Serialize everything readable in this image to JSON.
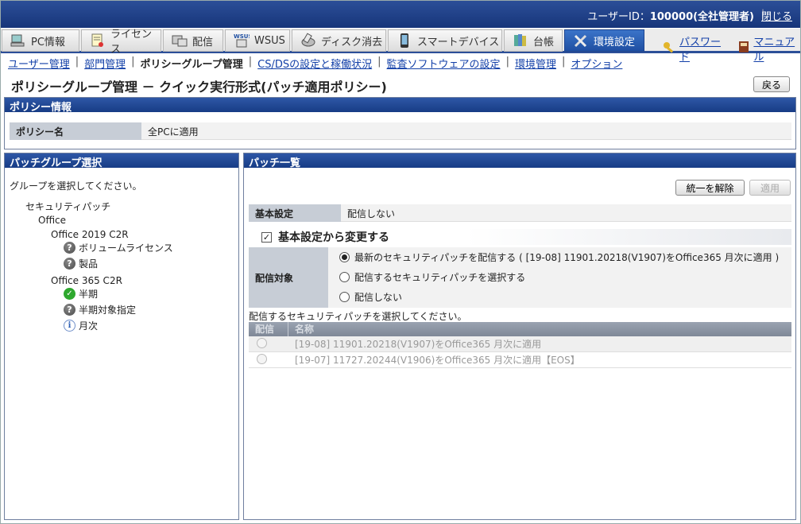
{
  "header": {
    "user_label": "ユーザーID：",
    "user_value": "100000(全社管理者)",
    "sep": "|",
    "logout": "閉じる"
  },
  "tabs": [
    {
      "label": "PC情報",
      "icon": "pc-icon"
    },
    {
      "label": "ライセンス",
      "icon": "license-icon"
    },
    {
      "label": "配信",
      "icon": "delivery-icon"
    },
    {
      "label": "WSUS",
      "icon": "wsus-icon",
      "badge": "WSUS"
    },
    {
      "label": "ディスク消去",
      "icon": "disk-erase-icon"
    },
    {
      "label": "スマートデバイス",
      "icon": "smartphone-icon"
    },
    {
      "label": "台帳",
      "icon": "ledger-icon"
    },
    {
      "label": "環境設定",
      "icon": "tools-icon",
      "active": true
    }
  ],
  "right_links": {
    "password": "パスワード",
    "manual": "マニュアル"
  },
  "submenu": [
    {
      "label": "ユーザー管理",
      "current": false
    },
    {
      "label": "部門管理",
      "current": false
    },
    {
      "label": "ポリシーグループ管理",
      "current": true
    },
    {
      "label": "CS/DSの設定と稼働状況",
      "current": false
    },
    {
      "label": "監査ソフトウェアの設定",
      "current": false
    },
    {
      "label": "環境管理",
      "current": false
    },
    {
      "label": "オプション",
      "current": false
    }
  ],
  "page": {
    "title": "ポリシーグループ管理 － クイック実行形式(パッチ適用ポリシー)",
    "back": "戻る"
  },
  "policy_info": {
    "heading": "ポリシー情報",
    "name_label": "ポリシー名",
    "name_value": "全PCに適用"
  },
  "group_select": {
    "heading": "パッチグループ選択",
    "intro": "グループを選択してください。",
    "tree": {
      "root": "セキュリティパッチ",
      "office": "Office",
      "o2019": "Office 2019 C2R",
      "volume": "ボリュームライセンス",
      "product": "製品",
      "o365": "Office 365 C2R",
      "half": "半期",
      "half_target": "半期対象指定",
      "monthly": "月次"
    }
  },
  "patch_list": {
    "heading": "パッチ一覧",
    "unify_btn": "統一を解除",
    "apply_btn": "適用",
    "basic_label": "基本設定",
    "basic_value": "配信しない",
    "change_label": "基本設定から変更する",
    "target_label": "配信対象",
    "options": [
      "最新のセキュリティパッチを配信する ( [19-08] 11901.20218(V1907)をOffice365 月次に適用 )",
      "配信するセキュリティパッチを選択する",
      "配信しない"
    ],
    "selected_option": 0,
    "note": "配信するセキュリティパッチを選択してください。",
    "columns": [
      "配信",
      "名称"
    ],
    "rows": [
      "[19-08] 11901.20218(V1907)をOffice365 月次に適用",
      "[19-07] 11727.20244(V1906)をOffice365 月次に適用【EOS】"
    ]
  }
}
